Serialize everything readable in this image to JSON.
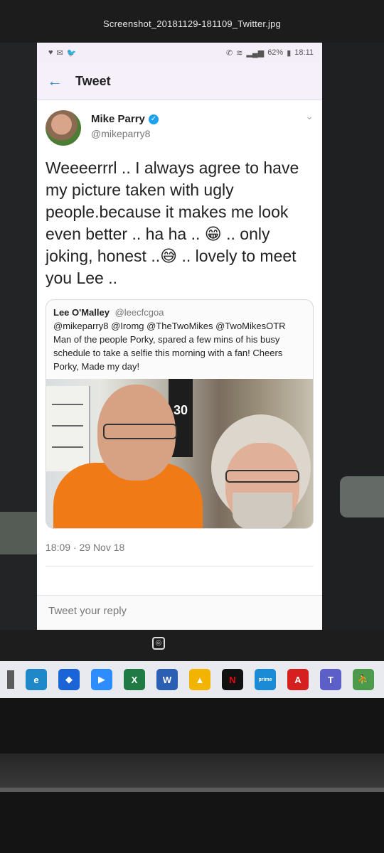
{
  "viewer": {
    "filename": "Screenshot_20181129-181109_Twitter.jpg"
  },
  "status_bar": {
    "battery": "62%",
    "time": "18:11",
    "left_icons": [
      "heart-icon",
      "mail-icon",
      "twitter-icon"
    ],
    "right_icons": [
      "call-icon",
      "wifi-icon",
      "signal-icon",
      "battery-icon"
    ]
  },
  "appbar": {
    "title": "Tweet"
  },
  "tweet": {
    "author_name": "Mike Parry",
    "author_handle": "@mikeparry8",
    "verified": true,
    "text": "Weeeerrrl .. I always agree to have my picture taken with ugly people.because it makes me look even better .. ha ha .. 😁 .. only joking, honest ..😅 .. lovely to meet you Lee ..",
    "timestamp": "18:09 · 29 Nov 18"
  },
  "quoted_tweet": {
    "author_name": "Lee O'Malley",
    "author_handle": "@leecfcgoa",
    "text": "@mikeparry8 @Iromg @TheTwoMikes @TwoMikesOTR Man of the people Porky, spared a few mins of his busy schedule to take a selfie this morning with a fan! Cheers Porky, Made my day!",
    "photo_sign_number": "30"
  },
  "reply": {
    "placeholder": "Tweet your reply"
  },
  "taskbar": {
    "items": [
      {
        "name": "edge",
        "label": "e",
        "color": "#1e88c8"
      },
      {
        "name": "dropbox",
        "label": "◆",
        "color": "#1a64d8"
      },
      {
        "name": "zoom",
        "label": "▶",
        "color": "#2d8cff"
      },
      {
        "name": "excel",
        "label": "X",
        "color": "#1f7a43"
      },
      {
        "name": "word",
        "label": "W",
        "color": "#2b5fb4"
      },
      {
        "name": "files",
        "label": "▲",
        "color": "#f2b400"
      },
      {
        "name": "netflix",
        "label": "N",
        "color": "#111111"
      },
      {
        "name": "prime-video",
        "label": "prime",
        "color": "#1b8bd6"
      },
      {
        "name": "acrobat",
        "label": "A",
        "color": "#d62020"
      },
      {
        "name": "teams",
        "label": "T",
        "color": "#5b5fc7"
      },
      {
        "name": "runner",
        "label": "⛹",
        "color": "#4c9a4c"
      }
    ]
  }
}
